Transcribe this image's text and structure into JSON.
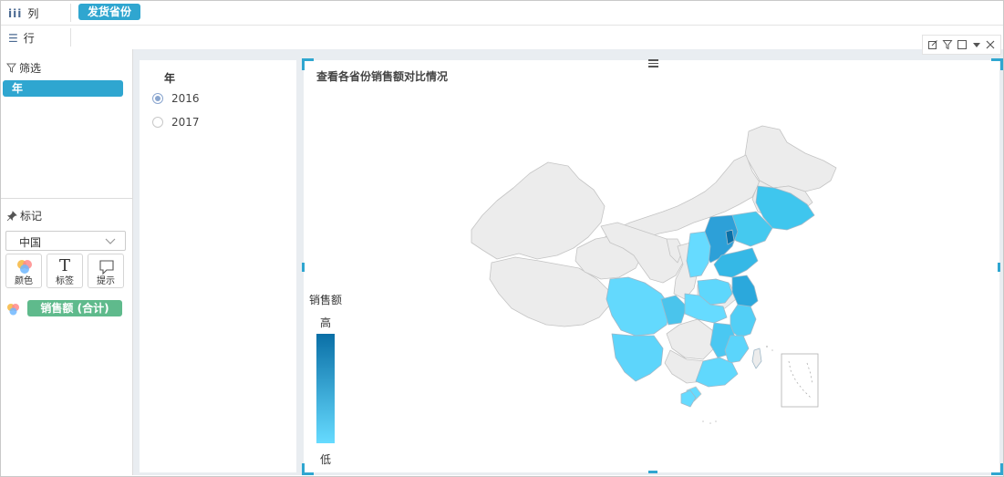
{
  "shelves": {
    "columns": {
      "label": "列",
      "icon": "columns-icon",
      "pill": "发货省份"
    },
    "rows": {
      "label": "行",
      "icon": "rows-icon"
    }
  },
  "filter_section": {
    "title": "筛选",
    "icon": "filter-icon",
    "pill": "年"
  },
  "marks_section": {
    "title": "标记",
    "icon": "pin-icon",
    "select_value": "中国",
    "buttons": {
      "color": "颜色",
      "label": "标签",
      "tooltip": "提示"
    },
    "color_field": "销售额 (合计)"
  },
  "filter_card": {
    "title": "年",
    "options": [
      "2016",
      "2017"
    ],
    "selected": "2016"
  },
  "map_card": {
    "title": "查看各省份销售额对比情况",
    "legend": {
      "title": "销售额",
      "high": "高",
      "low": "低",
      "color_high": "#0a6fa6",
      "color_low": "#66dbff"
    }
  },
  "colors": {
    "accent": "#2fa6d0",
    "measure_pill": "#5fba8c",
    "no_data": "#ececec"
  },
  "toolbar": [
    "edit-icon",
    "filter-icon",
    "maximize-icon",
    "dropdown-icon",
    "close-icon"
  ]
}
